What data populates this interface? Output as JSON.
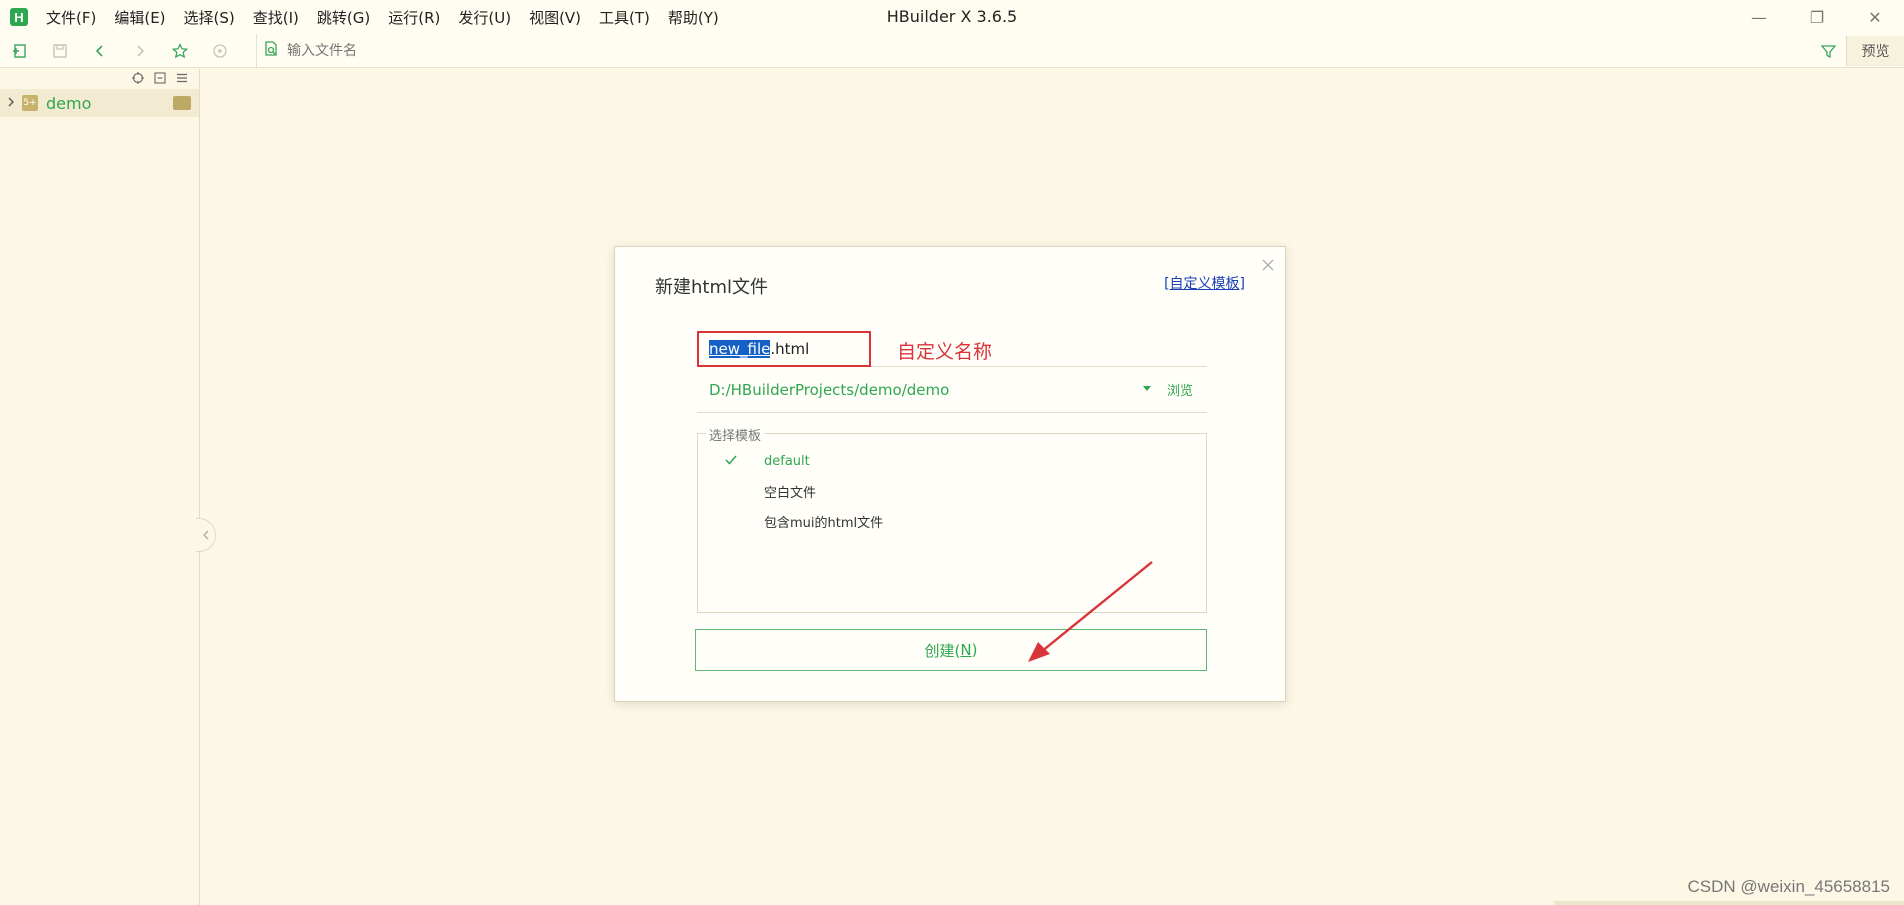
{
  "app": {
    "logo_letter": "H",
    "title": "HBuilder X 3.6.5",
    "menu": [
      "文件(F)",
      "编辑(E)",
      "选择(S)",
      "查找(I)",
      "跳转(G)",
      "运行(R)",
      "发行(U)",
      "视图(V)",
      "工具(T)",
      "帮助(Y)"
    ],
    "window_controls": {
      "minimize": "—",
      "restore": "❐",
      "close": "✕"
    }
  },
  "toolbar": {
    "search_placeholder": "输入文件名",
    "preview_label": "预览"
  },
  "sidebar": {
    "project_name": "demo",
    "project_icon_text": "5+"
  },
  "dialog": {
    "title": "新建html文件",
    "custom_template_link": "[自定义模板]",
    "filename_selected": "new_file",
    "filename_ext": ".html",
    "custom_name_note": "自定义名称",
    "path": "D:/HBuilderProjects/demo/demo",
    "browse_label": "浏览",
    "template_group_label": "选择模板",
    "templates": [
      {
        "label": "default",
        "selected": true
      },
      {
        "label": "空白文件",
        "selected": false
      },
      {
        "label": "包含mui的html文件",
        "selected": false
      }
    ],
    "create_label": "创建(",
    "create_mnemonic": "N",
    "create_suffix": ")"
  },
  "watermark": "CSDN @weixin_45658815",
  "colors": {
    "accent": "#2fa74f",
    "background": "#fdf8e6",
    "annotation": "#d9343a",
    "selection": "#1560c7"
  }
}
